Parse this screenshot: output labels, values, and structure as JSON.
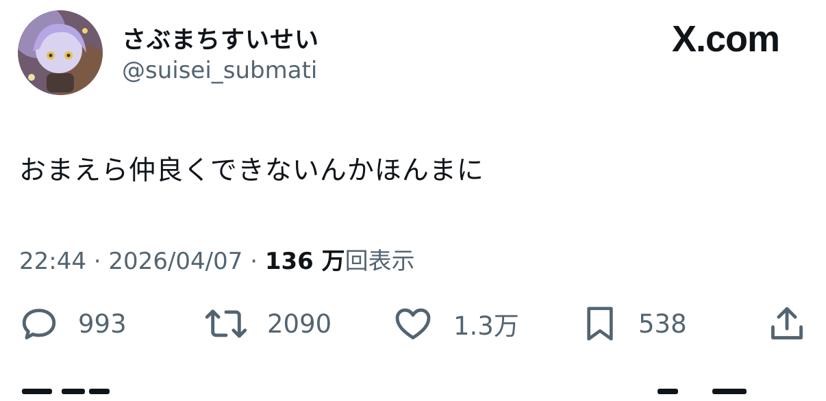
{
  "user": {
    "display_name": "さぶまちすいせい",
    "handle": "@suisei_submati"
  },
  "brand": "X.com",
  "tweet": {
    "text": "おまえら仲良くできないんかほんまに"
  },
  "meta": {
    "time": "22:44",
    "date": "2026/04/07",
    "views_count": "136 万",
    "views_label": "回表示",
    "separator": "·"
  },
  "actions": {
    "replies": "993",
    "retweets": "2090",
    "likes": "1.3万",
    "bookmarks": "538"
  },
  "icons": [
    "reply-icon",
    "retweet-icon",
    "like-icon",
    "bookmark-icon",
    "share-icon"
  ],
  "colors": {
    "text": "#0f1419",
    "secondary": "#536471",
    "background": "#ffffff"
  }
}
